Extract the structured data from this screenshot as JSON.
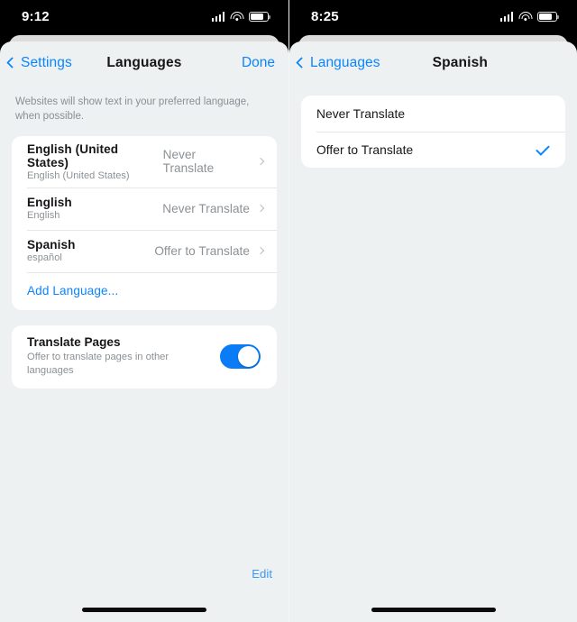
{
  "left": {
    "status": {
      "time": "9:12",
      "signal_icon": "cellular-signal-icon",
      "wifi_icon": "wifi-icon",
      "battery_icon": "battery-icon"
    },
    "nav": {
      "back_label": "Settings",
      "title": "Languages",
      "action_label": "Done"
    },
    "footnote": "Websites will show text in your preferred language, when possible.",
    "languages": [
      {
        "title": "English (United States)",
        "subtitle": "English (United States)",
        "value": "Never Translate"
      },
      {
        "title": "English",
        "subtitle": "English",
        "value": "Never Translate"
      },
      {
        "title": "Spanish",
        "subtitle": "español",
        "value": "Offer to Translate"
      }
    ],
    "add_language_label": "Add Language...",
    "translate_pages": {
      "title": "Translate Pages",
      "subtitle": "Offer to translate pages in other languages",
      "toggle_state": "on"
    },
    "edit_label": "Edit"
  },
  "right": {
    "status": {
      "time": "8:25",
      "signal_icon": "cellular-signal-icon",
      "wifi_icon": "wifi-icon",
      "battery_icon": "battery-icon"
    },
    "nav": {
      "back_label": "Languages",
      "title": "Spanish"
    },
    "options": [
      {
        "label": "Never Translate",
        "selected": false
      },
      {
        "label": "Offer to Translate",
        "selected": true
      }
    ]
  },
  "colors": {
    "accent": "#0a84ff",
    "toggle_on": "#0a7cf5",
    "sheet_bg": "#eef1f2",
    "card_bg": "#ffffff",
    "primary_text": "#161618",
    "secondary_text": "#8c9195"
  }
}
